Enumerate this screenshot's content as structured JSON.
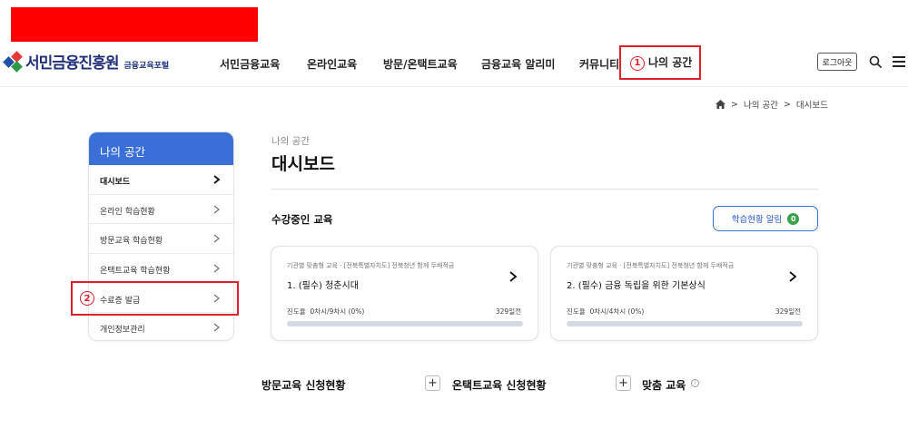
{
  "header": {
    "logo_name": "서민금융진흥원",
    "logo_sub": "금융교육포털",
    "nav": [
      {
        "label": "서민금융교육"
      },
      {
        "label": "온라인교육"
      },
      {
        "label": "방문/온택트교육"
      },
      {
        "label": "금융교육 알리미"
      },
      {
        "label": "커뮤니티"
      },
      {
        "label": "나의 공간"
      }
    ],
    "logout_label": "로그아웃",
    "annotation_1": "1"
  },
  "breadcrumb": {
    "items": [
      "나의 공간",
      "대시보드"
    ]
  },
  "sidebar": {
    "title": "나의 공간",
    "items": [
      {
        "label": "대시보드"
      },
      {
        "label": "온라인 학습현황"
      },
      {
        "label": "방문교육 학습현황"
      },
      {
        "label": "온택트교육 학습현황"
      },
      {
        "label": "수료증 발급"
      },
      {
        "label": "개인정보관리"
      }
    ],
    "annotation_2": "2"
  },
  "main": {
    "sub_title": "나의 공간",
    "page_title": "대시보드",
    "section_title": "수강중인 교육",
    "alert_button_label": "학습현황 알림",
    "alert_count": "0",
    "courses": [
      {
        "category": "기관별 맞춤형 교육 · [전북특별자치도] 전북청년 함께 두배적금",
        "name": "1. (필수) 청춘시대",
        "progress_label": "진도율",
        "progress_text": "0차시/9차시 (0%)",
        "progress_pct": 0,
        "days_left": "329일전"
      },
      {
        "category": "기관별 맞춤형 교육 · [전북특별자치도] 전북청년 함께 두배적금",
        "name": "2. (필수) 금융 독립을 위한 기본상식",
        "progress_label": "진도율",
        "progress_text": "0차시/4차시 (0%)",
        "progress_pct": 0,
        "days_left": "329일전"
      }
    ],
    "bottom_sections": [
      {
        "label": "방문교육 신청현황"
      },
      {
        "label": "온택트교육 신청현황"
      },
      {
        "label": "맞춤 교육"
      }
    ]
  }
}
